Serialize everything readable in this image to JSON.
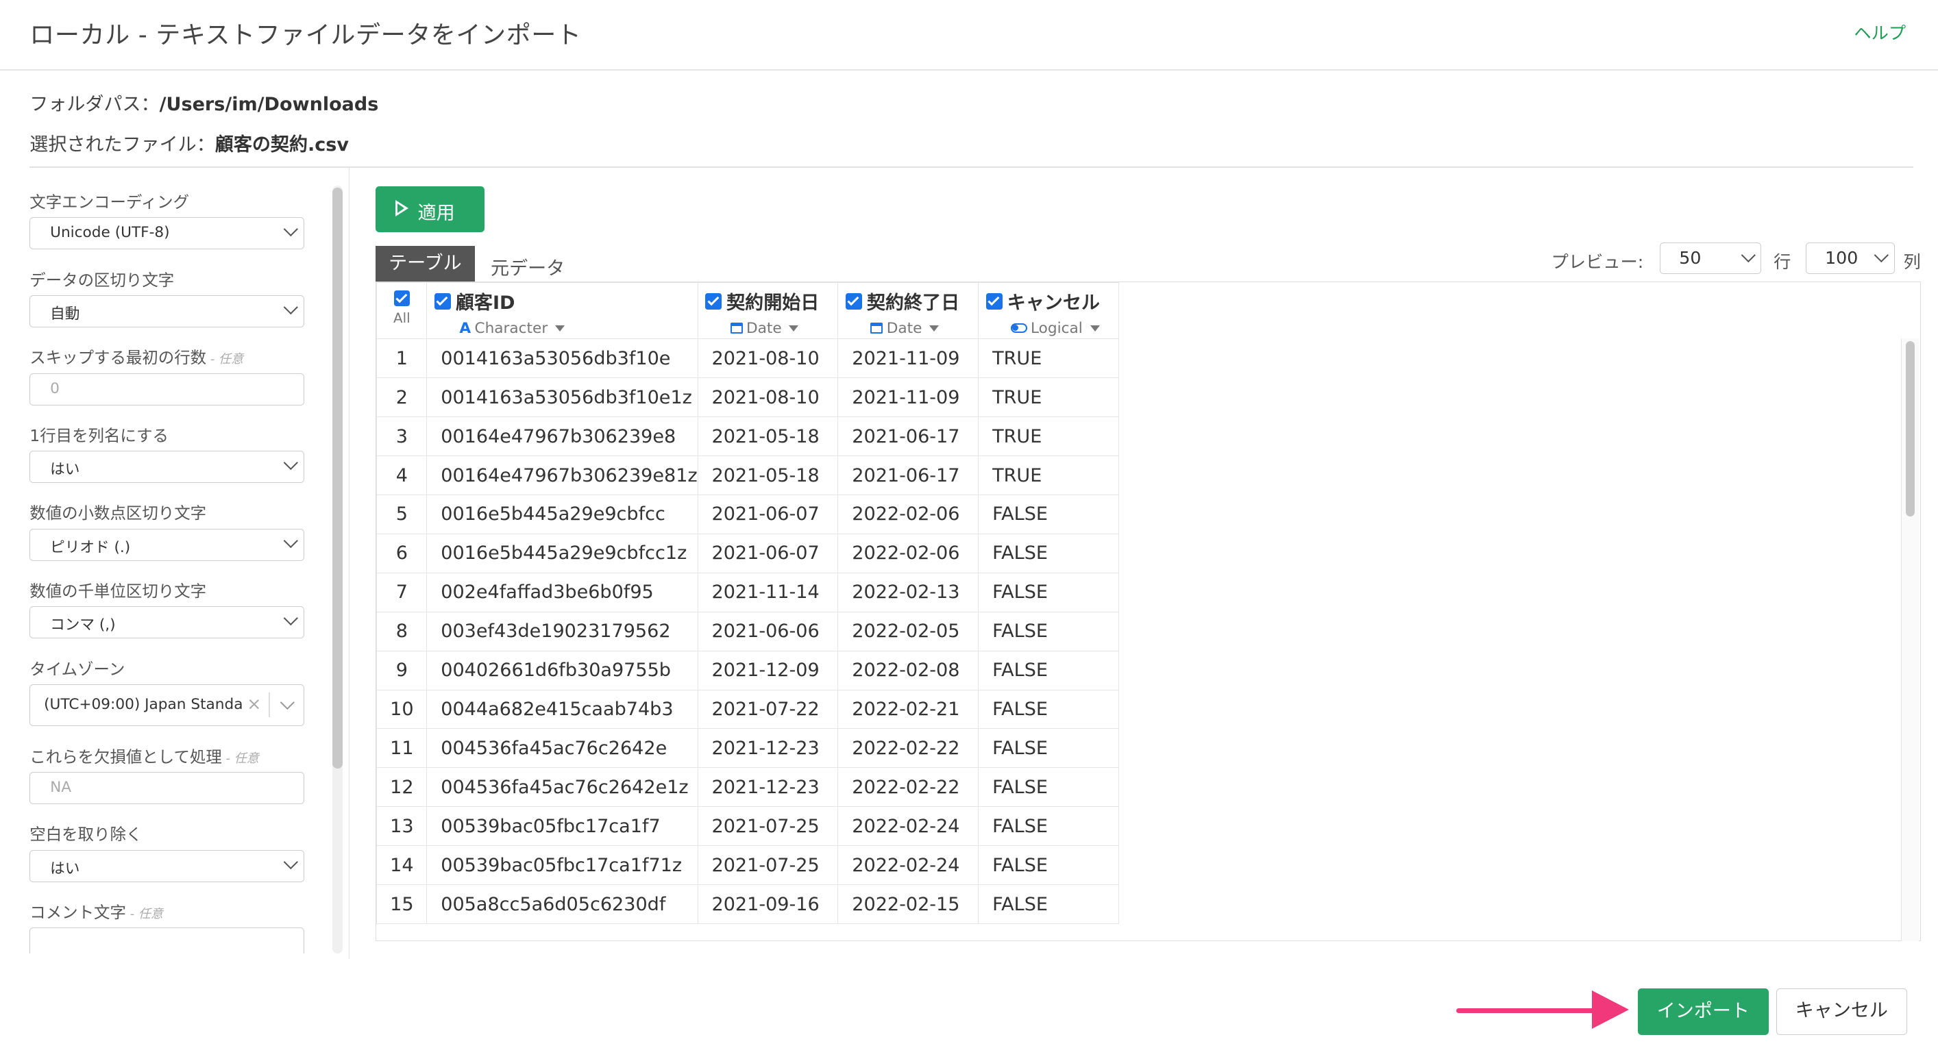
{
  "header": {
    "title": "ローカル - テキストファイルデータをインポート",
    "help": "ヘルプ"
  },
  "folder": {
    "label": "フォルダパス：",
    "value": "/Users/im/Downloads"
  },
  "file": {
    "label": "選択されたファイル：",
    "value": "顧客の契約.csv"
  },
  "sidebar": {
    "encoding": {
      "label": "文字エンコーディング",
      "value": "Unicode (UTF-8)"
    },
    "delimiter": {
      "label": "データの区切り文字",
      "value": "自動"
    },
    "skip": {
      "label": "スキップする最初の行数",
      "optional": " - 任意",
      "placeholder": "0"
    },
    "header_row": {
      "label": "1行目を列名にする",
      "value": "はい"
    },
    "decimal": {
      "label": "数値の小数点区切り文字",
      "value": "ピリオド (.)"
    },
    "thousands": {
      "label": "数値の千単位区切り文字",
      "value": "コンマ (,)"
    },
    "timezone": {
      "label": "タイムゾーン",
      "value": "(UTC+09:00) Japan Standa"
    },
    "na": {
      "label": "これらを欠損値として処理",
      "optional": " - 任意",
      "placeholder": "NA"
    },
    "trim": {
      "label": "空白を取り除く",
      "value": "はい"
    },
    "comment": {
      "label": "コメント文字",
      "optional": " - 任意",
      "value": ""
    }
  },
  "toolbar": {
    "apply": "適用",
    "tab_table": "テーブル",
    "tab_raw": "元データ",
    "preview_label": "プレビュー:",
    "rows_value": "50",
    "rows_unit": "行",
    "cols_value": "100",
    "cols_unit": "列"
  },
  "grid": {
    "all_label": "All",
    "columns": [
      {
        "name": "顧客ID",
        "type": "Character"
      },
      {
        "name": "契約開始日",
        "type": "Date"
      },
      {
        "name": "契約終了日",
        "type": "Date"
      },
      {
        "name": "キャンセル",
        "type": "Logical"
      }
    ],
    "rows": [
      [
        "1",
        "0014163a53056db3f10e",
        "2021-08-10",
        "2021-11-09",
        "TRUE"
      ],
      [
        "2",
        "0014163a53056db3f10e1z",
        "2021-08-10",
        "2021-11-09",
        "TRUE"
      ],
      [
        "3",
        "00164e47967b306239e8",
        "2021-05-18",
        "2021-06-17",
        "TRUE"
      ],
      [
        "4",
        "00164e47967b306239e81z",
        "2021-05-18",
        "2021-06-17",
        "TRUE"
      ],
      [
        "5",
        "0016e5b445a29e9cbfcc",
        "2021-06-07",
        "2022-02-06",
        "FALSE"
      ],
      [
        "6",
        "0016e5b445a29e9cbfcc1z",
        "2021-06-07",
        "2022-02-06",
        "FALSE"
      ],
      [
        "7",
        "002e4faffad3be6b0f95",
        "2021-11-14",
        "2022-02-13",
        "FALSE"
      ],
      [
        "8",
        "003ef43de19023179562",
        "2021-06-06",
        "2022-02-05",
        "FALSE"
      ],
      [
        "9",
        "00402661d6fb30a9755b",
        "2021-12-09",
        "2022-02-08",
        "FALSE"
      ],
      [
        "10",
        "0044a682e415caab74b3",
        "2021-07-22",
        "2022-02-21",
        "FALSE"
      ],
      [
        "11",
        "004536fa45ac76c2642e",
        "2021-12-23",
        "2022-02-22",
        "FALSE"
      ],
      [
        "12",
        "004536fa45ac76c2642e1z",
        "2021-12-23",
        "2022-02-22",
        "FALSE"
      ],
      [
        "13",
        "00539bac05fbc17ca1f7",
        "2021-07-25",
        "2022-02-24",
        "FALSE"
      ],
      [
        "14",
        "00539bac05fbc17ca1f71z",
        "2021-07-25",
        "2022-02-24",
        "FALSE"
      ],
      [
        "15",
        "005a8cc5a6d05c6230df",
        "2021-09-16",
        "2022-02-15",
        "FALSE"
      ]
    ]
  },
  "footer": {
    "import": "インポート",
    "cancel": "キャンセル"
  }
}
